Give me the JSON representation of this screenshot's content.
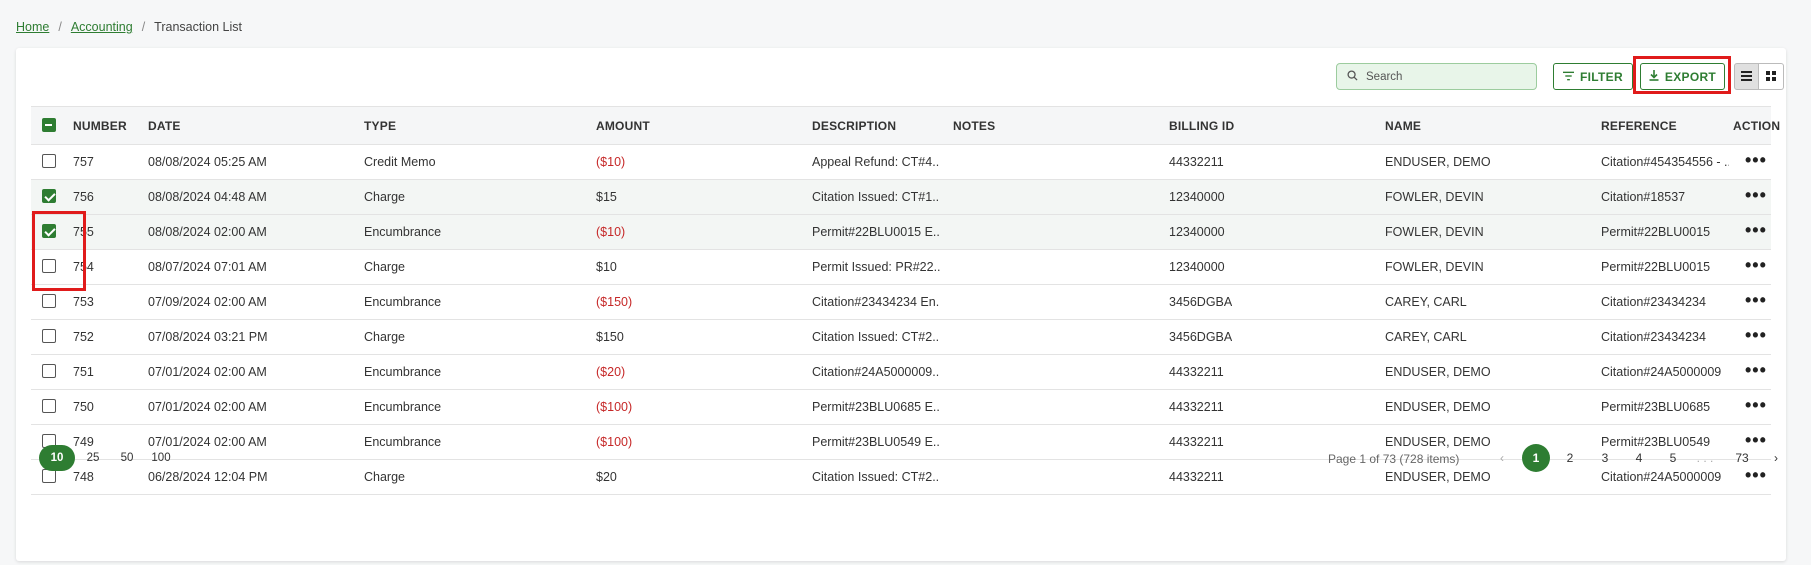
{
  "breadcrumb": {
    "home": "Home",
    "accounting": "Accounting",
    "current": "Transaction List"
  },
  "toolbar": {
    "search_placeholder": "Search",
    "filter_label": "FILTER",
    "export_label": "EXPORT"
  },
  "columns": {
    "number": "NUMBER",
    "date": "DATE",
    "type": "TYPE",
    "amount": "AMOUNT",
    "description": "DESCRIPTION",
    "notes": "NOTES",
    "billing_id": "BILLING ID",
    "name": "NAME",
    "reference": "REFERENCE",
    "action": "ACTION"
  },
  "rows": [
    {
      "number": "757",
      "date": "08/08/2024 05:25 AM",
      "type": "Credit Memo",
      "amount": "($10)",
      "description": "Appeal Refund: CT#4...",
      "notes": "",
      "billing_id": "44332211",
      "name": "ENDUSER, DEMO",
      "reference": "Citation#454354556 - ...",
      "checked": false
    },
    {
      "number": "756",
      "date": "08/08/2024 04:48 AM",
      "type": "Charge",
      "amount": "$15",
      "description": "Citation Issued: CT#1...",
      "notes": "",
      "billing_id": "12340000",
      "name": "FOWLER, DEVIN",
      "reference": "Citation#18537",
      "checked": true
    },
    {
      "number": "755",
      "date": "08/08/2024 02:00 AM",
      "type": "Encumbrance",
      "amount": "($10)",
      "description": "Permit#22BLU0015 E...",
      "notes": "",
      "billing_id": "12340000",
      "name": "FOWLER, DEVIN",
      "reference": "Permit#22BLU0015",
      "checked": true
    },
    {
      "number": "754",
      "date": "08/07/2024 07:01 AM",
      "type": "Charge",
      "amount": "$10",
      "description": "Permit Issued: PR#22...",
      "notes": "",
      "billing_id": "12340000",
      "name": "FOWLER, DEVIN",
      "reference": "Permit#22BLU0015",
      "checked": false
    },
    {
      "number": "753",
      "date": "07/09/2024 02:00 AM",
      "type": "Encumbrance",
      "amount": "($150)",
      "description": "Citation#23434234 En...",
      "notes": "",
      "billing_id": "3456DGBA",
      "name": "CAREY, CARL",
      "reference": "Citation#23434234",
      "checked": false
    },
    {
      "number": "752",
      "date": "07/08/2024 03:21 PM",
      "type": "Charge",
      "amount": "$150",
      "description": "Citation Issued: CT#2...",
      "notes": "",
      "billing_id": "3456DGBA",
      "name": "CAREY, CARL",
      "reference": "Citation#23434234",
      "checked": false
    },
    {
      "number": "751",
      "date": "07/01/2024 02:00 AM",
      "type": "Encumbrance",
      "amount": "($20)",
      "description": "Citation#24A5000009...",
      "notes": "",
      "billing_id": "44332211",
      "name": "ENDUSER, DEMO",
      "reference": "Citation#24A5000009",
      "checked": false
    },
    {
      "number": "750",
      "date": "07/01/2024 02:00 AM",
      "type": "Encumbrance",
      "amount": "($100)",
      "description": "Permit#23BLU0685 E...",
      "notes": "",
      "billing_id": "44332211",
      "name": "ENDUSER, DEMO",
      "reference": "Permit#23BLU0685",
      "checked": false
    },
    {
      "number": "749",
      "date": "07/01/2024 02:00 AM",
      "type": "Encumbrance",
      "amount": "($100)",
      "description": "Permit#23BLU0549 E...",
      "notes": "",
      "billing_id": "44332211",
      "name": "ENDUSER, DEMO",
      "reference": "Permit#23BLU0549",
      "checked": false
    },
    {
      "number": "748",
      "date": "06/28/2024 12:04 PM",
      "type": "Charge",
      "amount": "$20",
      "description": "Citation Issued: CT#2...",
      "notes": "",
      "billing_id": "44332211",
      "name": "ENDUSER, DEMO",
      "reference": "Citation#24A5000009",
      "checked": false
    }
  ],
  "row_action_label": "•••",
  "pagination": {
    "page_sizes": [
      "10",
      "25",
      "50",
      "100"
    ],
    "active_size": "10",
    "info": "Page 1 of 73 (728 items)",
    "prev": "‹",
    "pages": [
      "1",
      "2",
      "3",
      "4",
      "5"
    ],
    "ellipsis": ". . .",
    "last": "73",
    "next": "›",
    "active_page": "1"
  },
  "colors": {
    "accent": "#2e7d32",
    "negative": "#c62828",
    "highlight": "#e01b1b"
  },
  "icons": {
    "search": "search-icon",
    "filter": "filter-icon",
    "export": "download-icon",
    "list_view": "list-view-icon",
    "grid_view": "grid-view-icon"
  }
}
